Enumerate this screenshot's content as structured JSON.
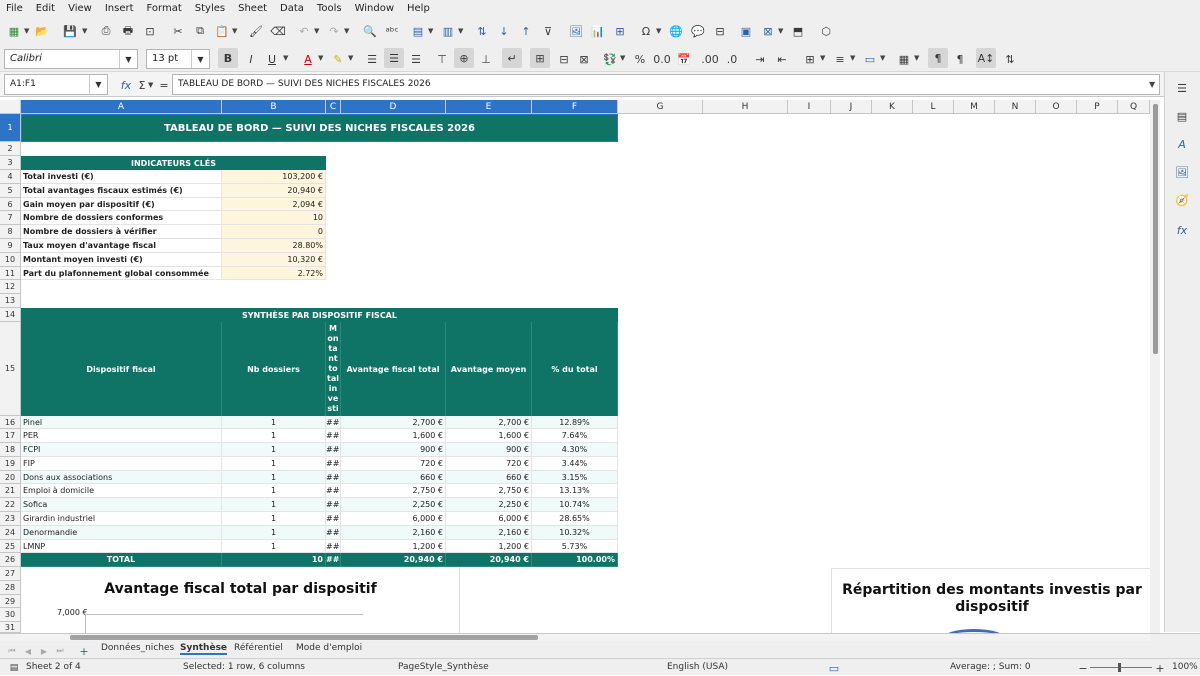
{
  "menubar": {
    "items": [
      "File",
      "Edit",
      "View",
      "Insert",
      "Format",
      "Styles",
      "Sheet",
      "Data",
      "Tools",
      "Window",
      "Help"
    ]
  },
  "toolbar": {
    "font_name": "Calibri",
    "font_size": "13 pt"
  },
  "formula_bar": {
    "cell_ref": "A1:F1",
    "fx": "fx",
    "sigma": "Σ",
    "equals": "=",
    "content": "TABLEAU DE BORD — SUIVI DES NICHES FISCALES 2026"
  },
  "columns": [
    "A",
    "B",
    "C",
    "D",
    "E",
    "F",
    "G",
    "H",
    "I",
    "J",
    "K",
    "L",
    "M",
    "N",
    "O",
    "P",
    "Q"
  ],
  "rows": [
    "1",
    "2",
    "3",
    "4",
    "5",
    "6",
    "7",
    "8",
    "9",
    "10",
    "11",
    "12",
    "13",
    "14",
    "15",
    "16",
    "17",
    "18",
    "19",
    "20",
    "21",
    "22",
    "23",
    "24",
    "25",
    "26",
    "27",
    "28",
    "29",
    "30",
    "31"
  ],
  "title": "TABLEAU DE BORD — SUIVI DES NICHES FISCALES 2026",
  "kpi": {
    "header": "INDICATEURS CLÉS",
    "items": [
      {
        "label": "Total investi (€)",
        "value": "103,200 €"
      },
      {
        "label": "Total avantages fiscaux estimés (€)",
        "value": "20,940 €"
      },
      {
        "label": "Gain moyen par dispositif (€)",
        "value": "2,094 €"
      },
      {
        "label": "Nombre de dossiers conformes",
        "value": "10"
      },
      {
        "label": "Nombre de dossiers à vérifier",
        "value": "0"
      },
      {
        "label": "Taux moyen d'avantage fiscal",
        "value": "28.80%"
      },
      {
        "label": "Montant moyen investi (€)",
        "value": "10,320 €"
      },
      {
        "label": "Part du plafonnement global consommée",
        "value": "2.72%"
      }
    ]
  },
  "synth": {
    "header": "SYNTHÈSE PAR DISPOSITIF FISCAL",
    "columns": [
      "Dispositif fiscal",
      "Nb dossiers",
      "Montant total investi",
      "Avantage fiscal total",
      "Avantage moyen",
      "% du total"
    ],
    "col_c_wrapped": [
      "M",
      "on",
      "ta",
      "nt",
      "to",
      "tal",
      "in",
      "ve",
      "sti"
    ],
    "rows": [
      {
        "name": "Pinel",
        "nb": "1",
        "mt": "###",
        "total": "2,700 €",
        "avg": "2,700 €",
        "pct": "12.89%"
      },
      {
        "name": "PER",
        "nb": "1",
        "mt": "###",
        "total": "1,600 €",
        "avg": "1,600 €",
        "pct": "7.64%"
      },
      {
        "name": "FCPI",
        "nb": "1",
        "mt": "###",
        "total": "900 €",
        "avg": "900 €",
        "pct": "4.30%"
      },
      {
        "name": "FIP",
        "nb": "1",
        "mt": "###",
        "total": "720 €",
        "avg": "720 €",
        "pct": "3.44%"
      },
      {
        "name": "Dons aux associations",
        "nb": "1",
        "mt": "###",
        "total": "660 €",
        "avg": "660 €",
        "pct": "3.15%"
      },
      {
        "name": "Emploi à domicile",
        "nb": "1",
        "mt": "###",
        "total": "2,750 €",
        "avg": "2,750 €",
        "pct": "13.13%"
      },
      {
        "name": "Sofica",
        "nb": "1",
        "mt": "###",
        "total": "2,250 €",
        "avg": "2,250 €",
        "pct": "10.74%"
      },
      {
        "name": "Girardin industriel",
        "nb": "1",
        "mt": "###",
        "total": "6,000 €",
        "avg": "6,000 €",
        "pct": "28.65%"
      },
      {
        "name": "Denormandie",
        "nb": "1",
        "mt": "###",
        "total": "2,160 €",
        "avg": "2,160 €",
        "pct": "10.32%"
      },
      {
        "name": "LMNP",
        "nb": "1",
        "mt": "###",
        "total": "1,200 €",
        "avg": "1,200 €",
        "pct": "5.73%"
      }
    ],
    "total": {
      "name": "TOTAL",
      "nb": "10",
      "mt": "###",
      "total": "20,940 €",
      "avg": "20,940 €",
      "pct": "100.00%"
    }
  },
  "chart1": {
    "title": "Avantage fiscal total par dispositif",
    "y_tick": "7,000 €"
  },
  "chart2": {
    "title_line1": "Répartition des montants investis par",
    "title_line2": "dispositif"
  },
  "sheets": {
    "tabs": [
      "Données_niches",
      "Synthèse",
      "Référentiel",
      "Mode d'emploi"
    ],
    "active": "Synthèse"
  },
  "status": {
    "sheet": "Sheet 2 of 4",
    "selection": "Selected: 1 row, 6 columns",
    "pagestyle": "PageStyle_Synthèse",
    "language": "English (USA)",
    "summary": "Average: ; Sum: 0",
    "zoom": "100%"
  }
}
